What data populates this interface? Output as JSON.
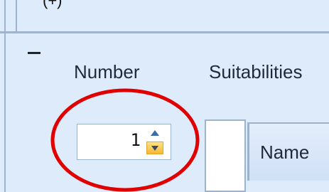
{
  "top_bar": {
    "partial_text": "(+)"
  },
  "group_panel": {
    "collapse_symbol": "–",
    "fields": {
      "number_label": "Number",
      "suitabilities_label": "Suitabilities"
    },
    "number_spinner": {
      "value": "1",
      "up_icon": "spin-up-arrow-icon",
      "down_icon": "spin-down-arrow-icon"
    },
    "suitabilities_grid": {
      "column_header": "Name"
    }
  },
  "annotation": {
    "shape": "ellipse",
    "color": "#e00000"
  }
}
